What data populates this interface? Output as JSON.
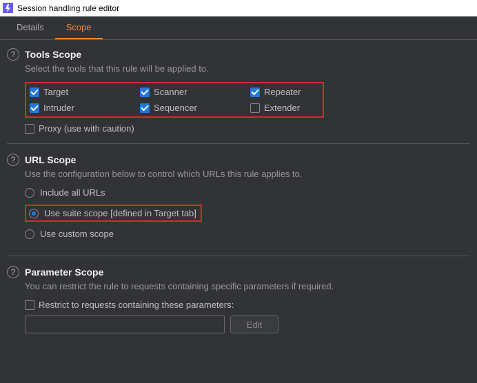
{
  "window": {
    "title": "Session handling rule editor"
  },
  "tabs": {
    "details": "Details",
    "scope": "Scope"
  },
  "tools_scope": {
    "title": "Tools Scope",
    "desc": "Select the tools that this rule will be applied to.",
    "items": {
      "target": {
        "label": "Target",
        "checked": true
      },
      "scanner": {
        "label": "Scanner",
        "checked": true
      },
      "repeater": {
        "label": "Repeater",
        "checked": true
      },
      "intruder": {
        "label": "Intruder",
        "checked": true
      },
      "sequencer": {
        "label": "Sequencer",
        "checked": true
      },
      "extender": {
        "label": "Extender",
        "checked": false
      }
    },
    "proxy": {
      "label": "Proxy (use with caution)",
      "checked": false
    }
  },
  "url_scope": {
    "title": "URL Scope",
    "desc": "Use the configuration below to control which URLs this rule applies to.",
    "options": {
      "all": {
        "label": "Include all URLs",
        "selected": false
      },
      "suite": {
        "label": "Use suite scope [defined in Target tab]",
        "selected": true
      },
      "custom": {
        "label": "Use custom scope",
        "selected": false
      }
    }
  },
  "param_scope": {
    "title": "Parameter Scope",
    "desc": "You can restrict the rule to requests containing specific parameters if required.",
    "restrict": {
      "label": "Restrict to requests containing these parameters:",
      "checked": false
    },
    "edit_label": "Edit",
    "field_value": ""
  }
}
